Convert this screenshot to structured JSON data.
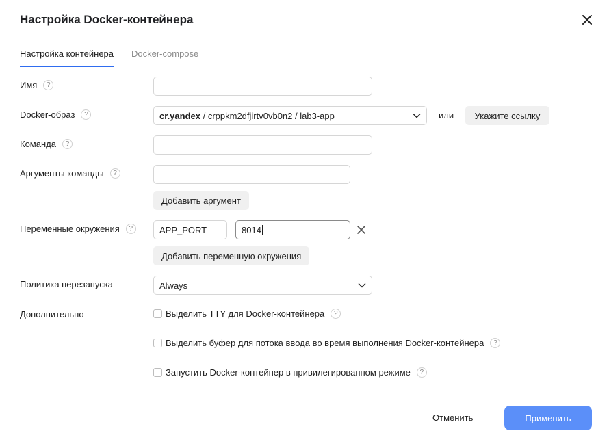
{
  "dialog": {
    "title": "Настройка Docker-контейнера",
    "close_icon": "close-icon"
  },
  "tabs": [
    {
      "label": "Настройка контейнера",
      "active": true
    },
    {
      "label": "Docker-compose",
      "active": false
    }
  ],
  "help_glyph": "?",
  "fields": {
    "name": {
      "label": "Имя",
      "value": ""
    },
    "image": {
      "label": "Docker-образ",
      "registry": "cr.yandex",
      "path": " / crppkm2dfjirtv0vb0n2 / lab3-app",
      "or_text": "или",
      "link_button": "Укажите ссылку"
    },
    "command": {
      "label": "Команда",
      "value": ""
    },
    "args": {
      "label": "Аргументы команды",
      "value": "",
      "add_button": "Добавить аргумент"
    },
    "env": {
      "label": "Переменные окружения",
      "key": "APP_PORT",
      "value": "8014",
      "add_button": "Добавить переменную окружения"
    },
    "restart": {
      "label": "Политика перезапуска",
      "selected": "Always"
    },
    "extra": {
      "label": "Дополнительно",
      "options": [
        {
          "label": "Выделить TTY для Docker-контейнера",
          "checked": false
        },
        {
          "label": "Выделить буфер для потока ввода во время выполнения Docker-контейнера",
          "checked": false
        },
        {
          "label": "Запустить Docker-контейнер в привилегированном режиме",
          "checked": false
        }
      ]
    }
  },
  "footer": {
    "cancel": "Отменить",
    "apply": "Применить"
  },
  "colors": {
    "primary": "#5b8ff9",
    "tab_underline": "#2f6df0",
    "secondary_button": "#f0f0f0"
  }
}
